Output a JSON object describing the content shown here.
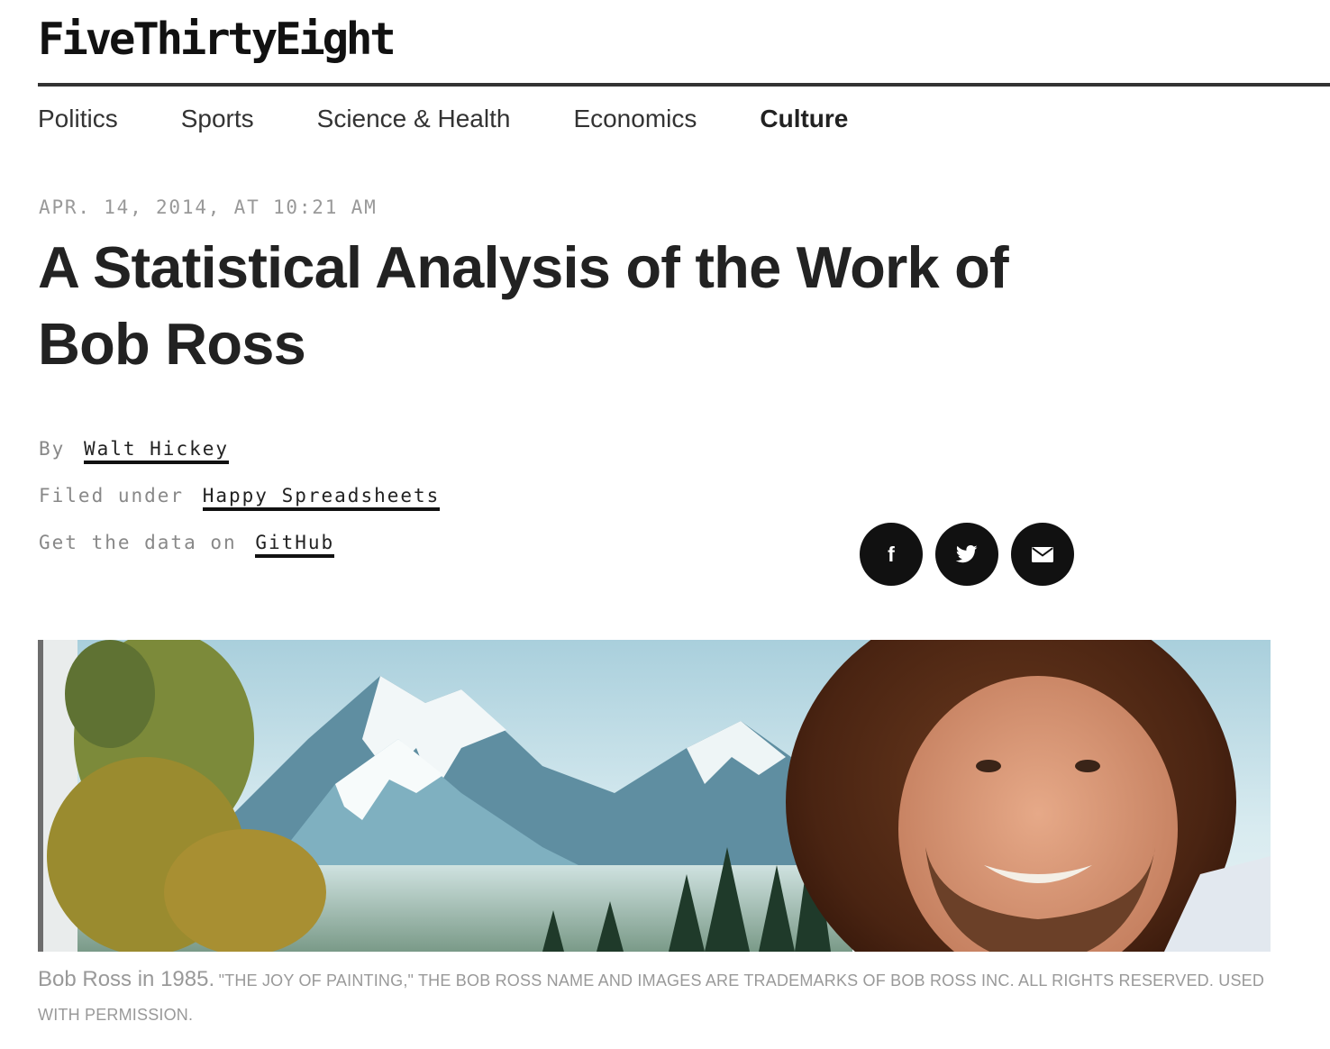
{
  "site": {
    "logo": "FiveThirtyEight"
  },
  "nav": {
    "items": [
      {
        "label": "Politics",
        "active": false
      },
      {
        "label": "Sports",
        "active": false
      },
      {
        "label": "Science & Health",
        "active": false
      },
      {
        "label": "Economics",
        "active": false
      },
      {
        "label": "Culture",
        "active": true
      }
    ]
  },
  "article": {
    "dateline": "APR. 14, 2014, AT 10:21 AM",
    "title": "A Statistical Analysis of the Work of Bob Ross",
    "byline": {
      "prefix": "By",
      "author": "Walt Hickey"
    },
    "filed": {
      "prefix": "Filed under",
      "topic": "Happy Spreadsheets"
    },
    "data": {
      "prefix": "Get the data on",
      "source": "GitHub"
    }
  },
  "share": {
    "buttons": [
      {
        "name": "facebook",
        "icon": "facebook-icon",
        "glyph": "f"
      },
      {
        "name": "twitter",
        "icon": "twitter-icon"
      },
      {
        "name": "email",
        "icon": "email-icon"
      }
    ]
  },
  "hero": {
    "caption_lead": "Bob Ross in 1985.",
    "caption_credit": "\"The Joy of Painting,\" the Bob Ross name and images are trademarks of Bob Ross Inc. All rights reserved. Used with permission."
  },
  "colors": {
    "text": "#222222",
    "meta": "#999999",
    "icon_bg": "#111111"
  }
}
